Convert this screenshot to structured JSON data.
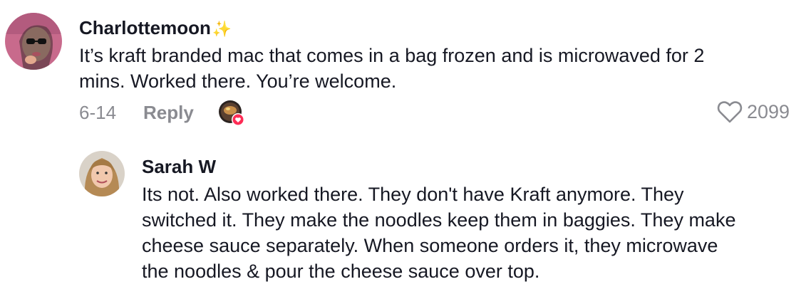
{
  "comments": [
    {
      "username": "Charlottemoon",
      "username_suffix": "✨",
      "avatar_icon": "user-avatar",
      "text_lines": [
        "It’s kraft branded mac that comes in a bag frozen and is microwaved for 2",
        "mins. Worked there. You’re welcome."
      ],
      "date": "6-14",
      "reply_label": "Reply",
      "like_count": "2099",
      "like_icon": "heart-outline-icon",
      "creator_liked_icon": "creator-liked-badge"
    },
    {
      "username": "Sarah W",
      "avatar_icon": "user-avatar",
      "text_lines": [
        "Its not. Also worked there. They don't have Kraft anymore. They",
        "switched it. They make the noodles keep them in baggies. They make",
        "cheese sauce separately. When someone orders it, they microwave",
        "the noodles & pour the cheese sauce over top."
      ]
    }
  ],
  "colors": {
    "text": "#161823",
    "muted": "#8a8b91",
    "heart_badge": "#fe2c55"
  }
}
